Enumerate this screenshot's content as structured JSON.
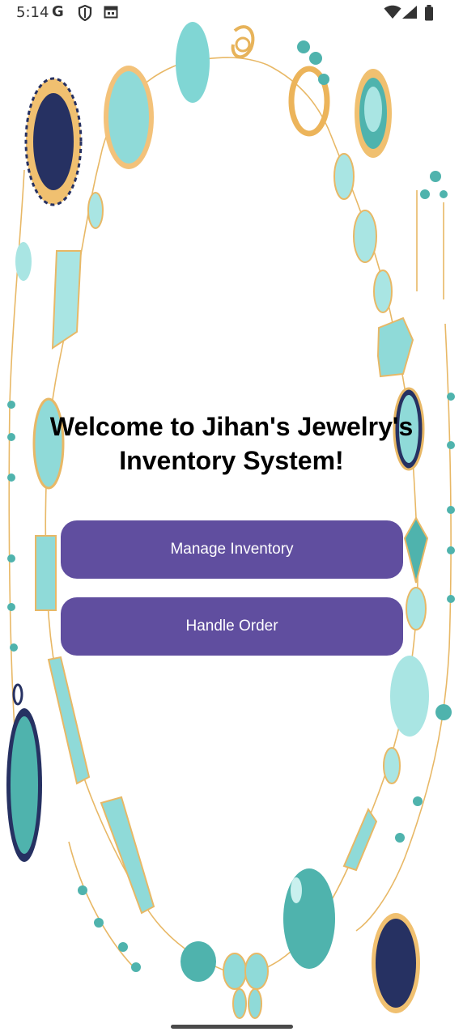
{
  "status_bar": {
    "time": "5:14",
    "google_glyph": "G",
    "icons": [
      "google-icon",
      "shield-icon",
      "calendar-icon",
      "wifi-icon",
      "signal-icon",
      "battery-icon"
    ]
  },
  "main": {
    "title": "Welcome to Jihan's Jewelry's Inventory System!",
    "manage_inventory_label": "Manage Inventory",
    "handle_order_label": "Handle Order"
  },
  "theme": {
    "button_color": "#604e9f",
    "button_text_color": "#ffffff",
    "gem_turquoise": "#8fdad8",
    "gem_teal": "#4fb3ad",
    "gem_navy": "#263162",
    "gold": "#f0c070"
  }
}
